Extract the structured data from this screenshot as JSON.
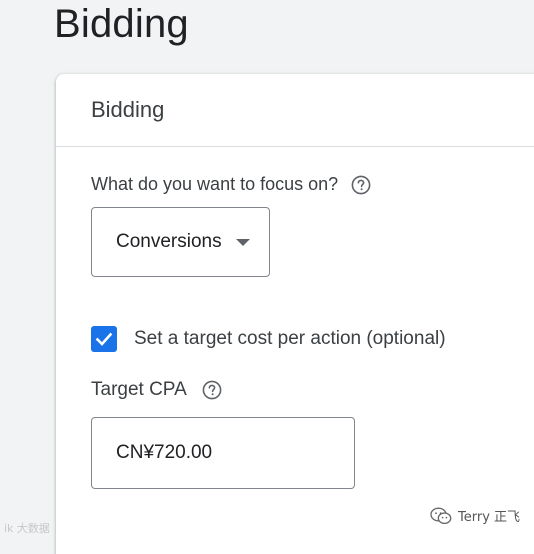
{
  "page": {
    "title": "Bidding"
  },
  "card": {
    "title": "Bidding",
    "focus_question": "What do you want to focus on?",
    "focus_help_icon": "help-circle-icon",
    "focus_selected": "Conversions",
    "target_cpa_checkbox": {
      "checked": true,
      "label": "Set a target cost per action (optional)"
    },
    "target_cpa_label": "Target CPA",
    "target_cpa_help_icon": "help-circle-icon",
    "target_cpa_value": "CN¥720.00"
  },
  "watermarks": {
    "left": "ik 大数据",
    "right": "Terry 正飞"
  },
  "colors": {
    "accent": "#1a73e8",
    "background": "#f1f3f4",
    "card": "#ffffff",
    "border": "#80868b"
  }
}
